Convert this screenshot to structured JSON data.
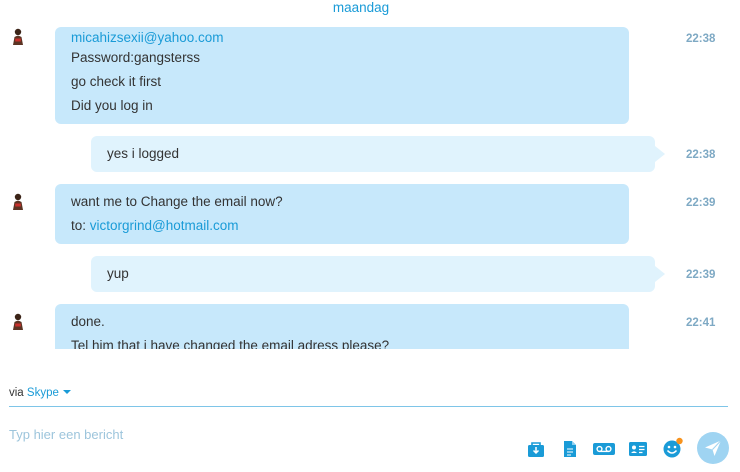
{
  "day_separator": "maandag",
  "messages": [
    {
      "direction": "in",
      "time": "22:38",
      "lines": [
        {
          "text": "micahizsexii@yahoo.com",
          "link": true
        },
        {
          "text": "Password:gangsterss"
        },
        {
          "text": "go check it first"
        },
        {
          "text": "Did you log in"
        }
      ]
    },
    {
      "direction": "out",
      "time": "22:38",
      "lines": [
        {
          "text": "yes i logged"
        }
      ]
    },
    {
      "direction": "in",
      "time": "22:39",
      "lines": [
        {
          "text": "want me to Change the email now?"
        },
        {
          "prefix": "to: ",
          "text": "victorgrind@hotmail.com",
          "link": true
        }
      ]
    },
    {
      "direction": "out",
      "time": "22:39",
      "lines": [
        {
          "text": "yup"
        }
      ]
    },
    {
      "direction": "in",
      "time": "22:41",
      "lines": [
        {
          "text": "done."
        },
        {
          "text": "Tel him that i have changed the email adress please?"
        }
      ]
    }
  ],
  "composer": {
    "via_label": "via",
    "service": "Skype",
    "placeholder": "Typ hier een bericht"
  },
  "toolbar": {
    "icons": [
      "send-media-icon",
      "send-file-icon",
      "video-message-icon",
      "send-contact-icon",
      "emoticon-icon",
      "send-icon"
    ]
  },
  "colors": {
    "accent": "#1a9bd7",
    "incoming_bubble": "#c7e8fb",
    "outgoing_bubble": "#e0f3fd",
    "timestamp": "#7ea9c4",
    "send_button": "#9fd4f2"
  }
}
